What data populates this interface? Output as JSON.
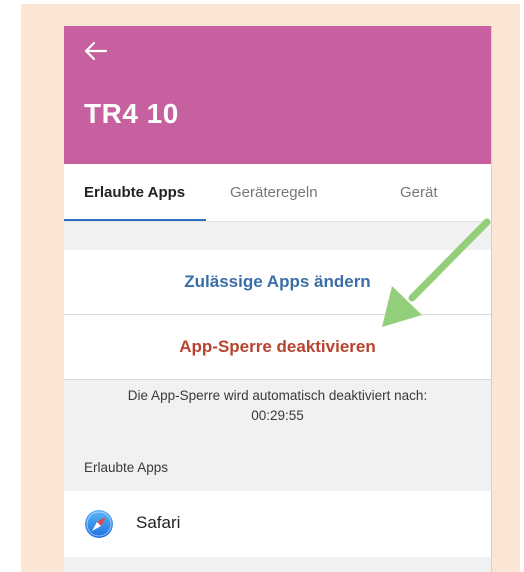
{
  "header": {
    "title": "TR4 10",
    "back_icon": "arrow-left-icon",
    "color": "#c7609e"
  },
  "tabs": [
    {
      "label": "Erlaubte Apps",
      "active": true
    },
    {
      "label": "Geräteregeln",
      "active": false
    },
    {
      "label": "Gerät",
      "active": false
    }
  ],
  "actions": {
    "change_apps_label": "Zulässige Apps ändern",
    "disable_lock_label": "App-Sperre deaktivieren"
  },
  "notice": {
    "text": "Die App-Sperre wird automatisch deaktiviert nach:",
    "countdown": "00:29:55"
  },
  "allowed_apps": {
    "section_label": "Erlaubte Apps",
    "items": [
      {
        "name": "Safari",
        "icon": "safari-compass-icon"
      }
    ]
  },
  "annotation": {
    "icon": "green-arrow-icon",
    "color": "#93cf7a"
  },
  "colors": {
    "frame_background": "#fbe6d6",
    "tab_indicator": "#2f6fc2",
    "change_apps_text": "#3a6ea8",
    "disable_lock_text": "#b7432f"
  }
}
